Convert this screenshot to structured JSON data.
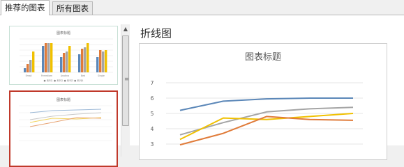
{
  "tabs": [
    {
      "label": "推荐的图表",
      "active": true
    },
    {
      "label": "所有图表",
      "active": false
    }
  ],
  "selected_type": "折线图",
  "thumbnails": [
    {
      "title": "图表标题",
      "categories": [
        "Email",
        "Ferentiam",
        "Anatina",
        "Bed",
        "Single"
      ],
      "legend": [
        "● 系列1",
        "● 系列2",
        "● 系列3",
        "● 系列4"
      ],
      "selected": false
    },
    {
      "title": "图表标题",
      "selected": true
    }
  ],
  "chart_data": {
    "type": "line",
    "title": "图表标题",
    "x": [
      1,
      2,
      3,
      4,
      5
    ],
    "ylim": [
      2,
      7
    ],
    "yticks": [
      "7",
      "6",
      "5",
      "4",
      "3"
    ],
    "series": [
      {
        "color": "#5b87b8",
        "values": [
          5.2,
          5.8,
          5.95,
          6.0,
          6.0
        ]
      },
      {
        "color": "#a5a5a5",
        "values": [
          3.6,
          4.4,
          5.1,
          5.3,
          5.4
        ]
      },
      {
        "color": "#f0c000",
        "values": [
          3.3,
          4.7,
          4.6,
          4.8,
          5.0
        ]
      },
      {
        "color": "#e07b39",
        "values": [
          2.95,
          3.7,
          4.8,
          4.6,
          4.55
        ]
      }
    ]
  }
}
